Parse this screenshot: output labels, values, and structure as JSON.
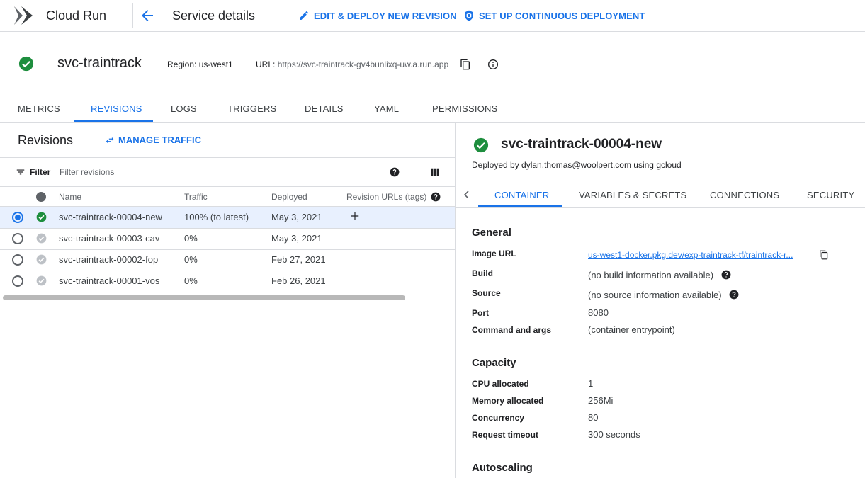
{
  "app": {
    "title": "Cloud Run"
  },
  "header": {
    "page_title": "Service details",
    "actions": [
      {
        "label": "EDIT & DEPLOY NEW REVISION",
        "icon": "pencil-icon"
      },
      {
        "label": "SET UP CONTINUOUS DEPLOYMENT",
        "icon": "deploy-shield-icon"
      }
    ]
  },
  "service": {
    "name": "svc-traintrack",
    "region": "Region: us-west1",
    "url_label": "URL:",
    "url": "https://svc-traintrack-gv4bunlixq-uw.a.run.app"
  },
  "tabs": [
    {
      "label": "METRICS",
      "active": false
    },
    {
      "label": "REVISIONS",
      "active": true
    },
    {
      "label": "LOGS",
      "active": false
    },
    {
      "label": "TRIGGERS",
      "active": false
    },
    {
      "label": "DETAILS",
      "active": false
    },
    {
      "label": "YAML",
      "active": false
    },
    {
      "label": "PERMISSIONS",
      "active": false
    }
  ],
  "revisions": {
    "title": "Revisions",
    "manage_traffic": "MANAGE TRAFFIC",
    "filter_label": "Filter",
    "filter_placeholder": "Filter revisions",
    "columns": [
      "Name",
      "Traffic",
      "Deployed",
      "Revision URLs (tags)"
    ],
    "rows": [
      {
        "name": "svc-traintrack-00004-new",
        "traffic": "100% (to latest)",
        "deployed": "May 3, 2021",
        "selected": true,
        "active": true
      },
      {
        "name": "svc-traintrack-00003-cav",
        "traffic": "0%",
        "deployed": "May 3, 2021",
        "selected": false,
        "active": false
      },
      {
        "name": "svc-traintrack-00002-fop",
        "traffic": "0%",
        "deployed": "Feb 27, 2021",
        "selected": false,
        "active": false
      },
      {
        "name": "svc-traintrack-00001-vos",
        "traffic": "0%",
        "deployed": "Feb 26, 2021",
        "selected": false,
        "active": false
      }
    ]
  },
  "detail": {
    "revision_name": "svc-traintrack-00004-new",
    "deployed_by": "Deployed by dylan.thomas@woolpert.com using gcloud",
    "tabs": [
      {
        "label": "CONTAINER",
        "active": true
      },
      {
        "label": "VARIABLES & SECRETS",
        "active": false
      },
      {
        "label": "CONNECTIONS",
        "active": false
      },
      {
        "label": "SECURITY",
        "active": false
      }
    ],
    "general": {
      "title": "General",
      "image_url_label": "Image URL",
      "image_url": "us-west1-docker.pkg.dev/exp-traintrack-tf/traintrack-r...",
      "build_label": "Build",
      "build": "(no build information available)",
      "source_label": "Source",
      "source": "(no source information available)",
      "port_label": "Port",
      "port": "8080",
      "command_label": "Command and args",
      "command": "(container entrypoint)"
    },
    "capacity": {
      "title": "Capacity",
      "cpu_label": "CPU allocated",
      "cpu": "1",
      "memory_label": "Memory allocated",
      "memory": "256Mi",
      "concurrency_label": "Concurrency",
      "concurrency": "80",
      "timeout_label": "Request timeout",
      "timeout": "300 seconds"
    },
    "autoscaling": {
      "title": "Autoscaling"
    }
  },
  "colors": {
    "accent": "#1a73e8",
    "success": "#1e8e3e",
    "selected_row": "#e8f0fe"
  }
}
